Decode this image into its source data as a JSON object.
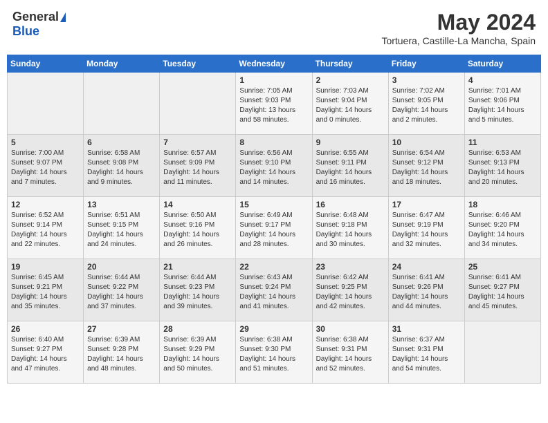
{
  "header": {
    "logo_general": "General",
    "logo_blue": "Blue",
    "title": "May 2024",
    "subtitle": "Tortuera, Castille-La Mancha, Spain"
  },
  "weekdays": [
    "Sunday",
    "Monday",
    "Tuesday",
    "Wednesday",
    "Thursday",
    "Friday",
    "Saturday"
  ],
  "weeks": [
    [
      {
        "day": "",
        "info": ""
      },
      {
        "day": "",
        "info": ""
      },
      {
        "day": "",
        "info": ""
      },
      {
        "day": "1",
        "info": "Sunrise: 7:05 AM\nSunset: 9:03 PM\nDaylight: 13 hours\nand 58 minutes."
      },
      {
        "day": "2",
        "info": "Sunrise: 7:03 AM\nSunset: 9:04 PM\nDaylight: 14 hours\nand 0 minutes."
      },
      {
        "day": "3",
        "info": "Sunrise: 7:02 AM\nSunset: 9:05 PM\nDaylight: 14 hours\nand 2 minutes."
      },
      {
        "day": "4",
        "info": "Sunrise: 7:01 AM\nSunset: 9:06 PM\nDaylight: 14 hours\nand 5 minutes."
      }
    ],
    [
      {
        "day": "5",
        "info": "Sunrise: 7:00 AM\nSunset: 9:07 PM\nDaylight: 14 hours\nand 7 minutes."
      },
      {
        "day": "6",
        "info": "Sunrise: 6:58 AM\nSunset: 9:08 PM\nDaylight: 14 hours\nand 9 minutes."
      },
      {
        "day": "7",
        "info": "Sunrise: 6:57 AM\nSunset: 9:09 PM\nDaylight: 14 hours\nand 11 minutes."
      },
      {
        "day": "8",
        "info": "Sunrise: 6:56 AM\nSunset: 9:10 PM\nDaylight: 14 hours\nand 14 minutes."
      },
      {
        "day": "9",
        "info": "Sunrise: 6:55 AM\nSunset: 9:11 PM\nDaylight: 14 hours\nand 16 minutes."
      },
      {
        "day": "10",
        "info": "Sunrise: 6:54 AM\nSunset: 9:12 PM\nDaylight: 14 hours\nand 18 minutes."
      },
      {
        "day": "11",
        "info": "Sunrise: 6:53 AM\nSunset: 9:13 PM\nDaylight: 14 hours\nand 20 minutes."
      }
    ],
    [
      {
        "day": "12",
        "info": "Sunrise: 6:52 AM\nSunset: 9:14 PM\nDaylight: 14 hours\nand 22 minutes."
      },
      {
        "day": "13",
        "info": "Sunrise: 6:51 AM\nSunset: 9:15 PM\nDaylight: 14 hours\nand 24 minutes."
      },
      {
        "day": "14",
        "info": "Sunrise: 6:50 AM\nSunset: 9:16 PM\nDaylight: 14 hours\nand 26 minutes."
      },
      {
        "day": "15",
        "info": "Sunrise: 6:49 AM\nSunset: 9:17 PM\nDaylight: 14 hours\nand 28 minutes."
      },
      {
        "day": "16",
        "info": "Sunrise: 6:48 AM\nSunset: 9:18 PM\nDaylight: 14 hours\nand 30 minutes."
      },
      {
        "day": "17",
        "info": "Sunrise: 6:47 AM\nSunset: 9:19 PM\nDaylight: 14 hours\nand 32 minutes."
      },
      {
        "day": "18",
        "info": "Sunrise: 6:46 AM\nSunset: 9:20 PM\nDaylight: 14 hours\nand 34 minutes."
      }
    ],
    [
      {
        "day": "19",
        "info": "Sunrise: 6:45 AM\nSunset: 9:21 PM\nDaylight: 14 hours\nand 35 minutes."
      },
      {
        "day": "20",
        "info": "Sunrise: 6:44 AM\nSunset: 9:22 PM\nDaylight: 14 hours\nand 37 minutes."
      },
      {
        "day": "21",
        "info": "Sunrise: 6:44 AM\nSunset: 9:23 PM\nDaylight: 14 hours\nand 39 minutes."
      },
      {
        "day": "22",
        "info": "Sunrise: 6:43 AM\nSunset: 9:24 PM\nDaylight: 14 hours\nand 41 minutes."
      },
      {
        "day": "23",
        "info": "Sunrise: 6:42 AM\nSunset: 9:25 PM\nDaylight: 14 hours\nand 42 minutes."
      },
      {
        "day": "24",
        "info": "Sunrise: 6:41 AM\nSunset: 9:26 PM\nDaylight: 14 hours\nand 44 minutes."
      },
      {
        "day": "25",
        "info": "Sunrise: 6:41 AM\nSunset: 9:27 PM\nDaylight: 14 hours\nand 45 minutes."
      }
    ],
    [
      {
        "day": "26",
        "info": "Sunrise: 6:40 AM\nSunset: 9:27 PM\nDaylight: 14 hours\nand 47 minutes."
      },
      {
        "day": "27",
        "info": "Sunrise: 6:39 AM\nSunset: 9:28 PM\nDaylight: 14 hours\nand 48 minutes."
      },
      {
        "day": "28",
        "info": "Sunrise: 6:39 AM\nSunset: 9:29 PM\nDaylight: 14 hours\nand 50 minutes."
      },
      {
        "day": "29",
        "info": "Sunrise: 6:38 AM\nSunset: 9:30 PM\nDaylight: 14 hours\nand 51 minutes."
      },
      {
        "day": "30",
        "info": "Sunrise: 6:38 AM\nSunset: 9:31 PM\nDaylight: 14 hours\nand 52 minutes."
      },
      {
        "day": "31",
        "info": "Sunrise: 6:37 AM\nSunset: 9:31 PM\nDaylight: 14 hours\nand 54 minutes."
      },
      {
        "day": "",
        "info": ""
      }
    ]
  ]
}
